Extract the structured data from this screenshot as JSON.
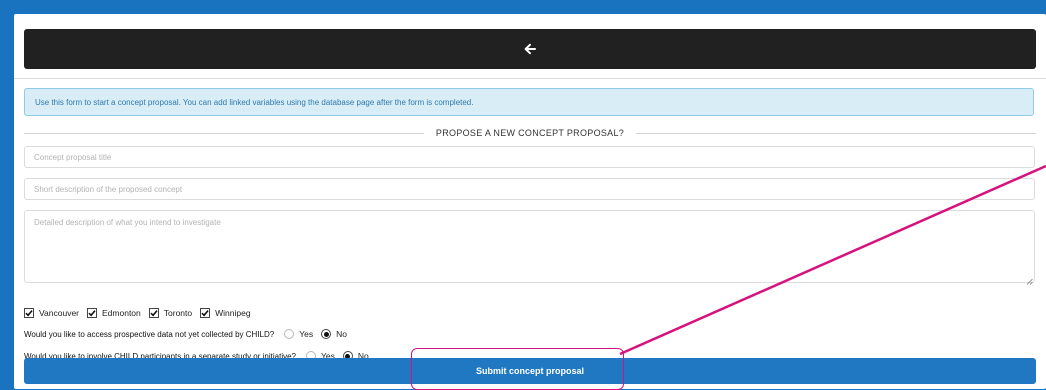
{
  "header": {
    "back_icon": "arrow-left-icon"
  },
  "info": {
    "text": "Use this form to start a concept proposal. You can add linked variables using the database page after the form is completed."
  },
  "section": {
    "title": "PROPOSE A NEW CONCEPT PROPOSAL?"
  },
  "form": {
    "title_placeholder": "Concept proposal title",
    "short_placeholder": "Short description of the proposed concept",
    "detail_placeholder": "Detailed description of what you intend to investigate",
    "sites": [
      {
        "label": "Vancouver",
        "checked": true
      },
      {
        "label": "Edmonton",
        "checked": true
      },
      {
        "label": "Toronto",
        "checked": true
      },
      {
        "label": "Winnipeg",
        "checked": true
      }
    ],
    "q1": {
      "text": "Would you like to access prospective data not yet collected by CHILD?",
      "yes": "Yes",
      "no": "No",
      "selected": "No"
    },
    "q2": {
      "text": "Would you like to involve CHILD participants in a separate study or initiative?",
      "yes": "Yes",
      "no": "No",
      "selected": "No"
    },
    "submit_label": "Submit concept proposal"
  },
  "colors": {
    "accent": "#1f78c1",
    "annotation": "#d6127e",
    "info_bg": "#d9edf7"
  }
}
